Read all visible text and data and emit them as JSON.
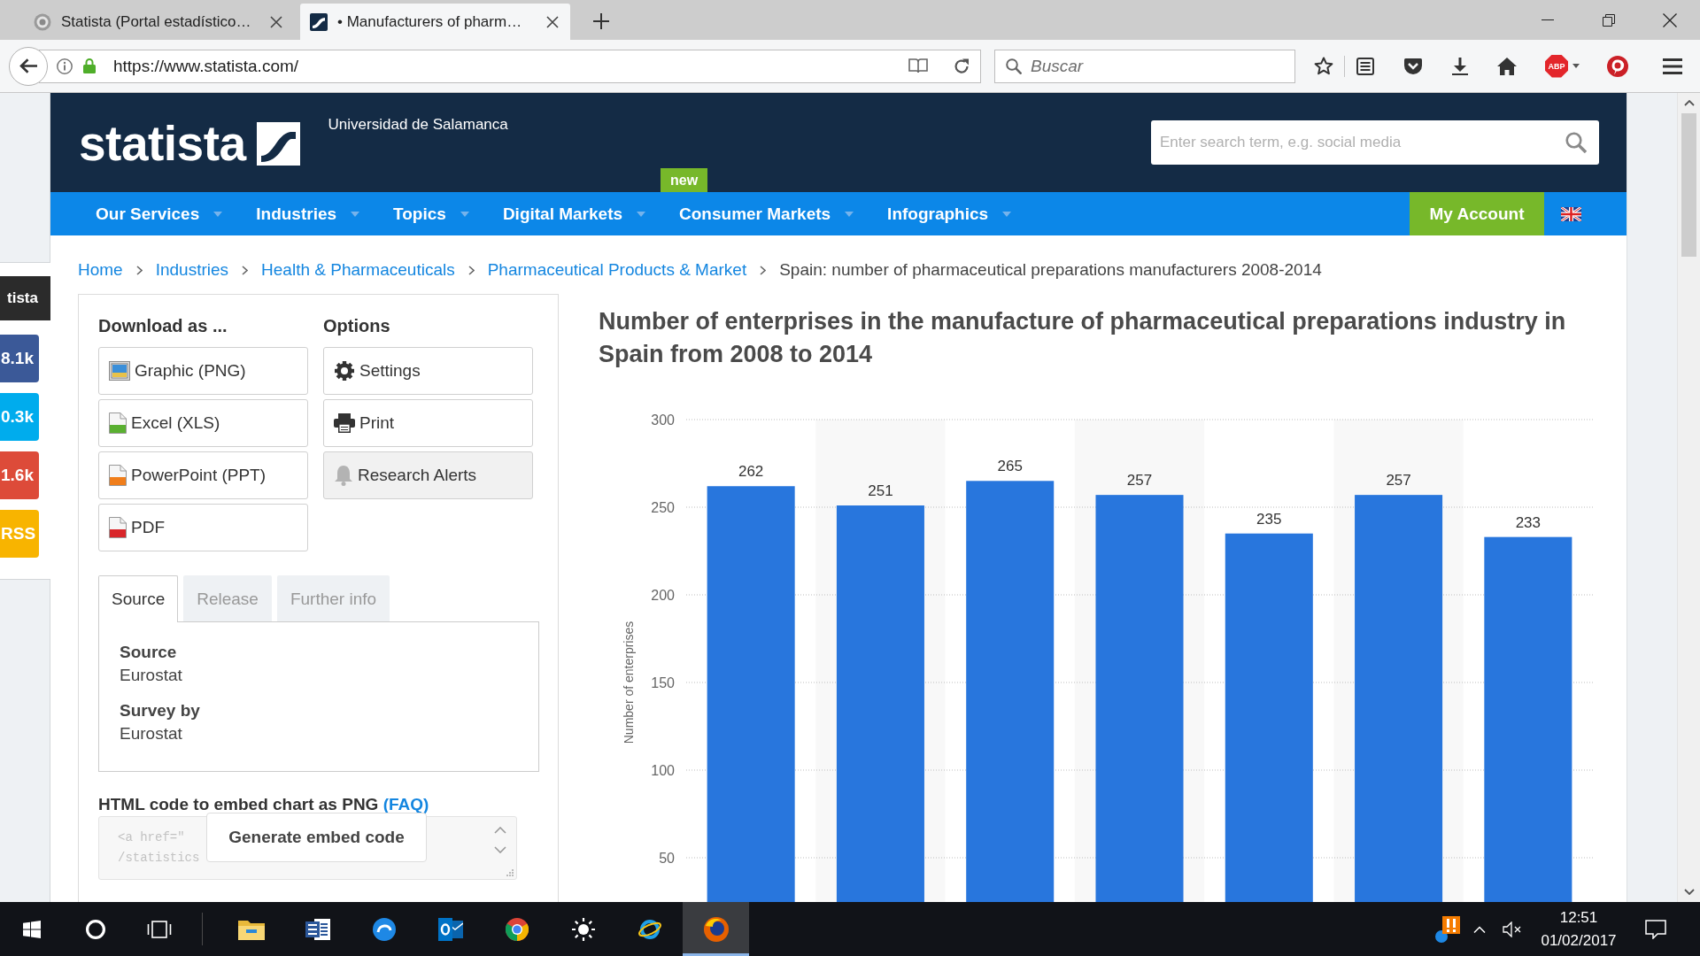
{
  "browser": {
    "tabs": [
      {
        "title": "Statista (Portal estadístico…",
        "kind": "seal",
        "selected": false
      },
      {
        "title": "• Manufacturers of pharm…",
        "kind": "logo",
        "selected": true
      }
    ],
    "url": "https://www.statista.com/",
    "search": {
      "placeholder": "Buscar"
    },
    "adblock_label": "ABP"
  },
  "site": {
    "logo": "statista",
    "institution": "Universidad de Salamanca",
    "search": {
      "placeholder": "Enter search term, e.g. social media"
    }
  },
  "nav": {
    "items": [
      {
        "label": "Our Services"
      },
      {
        "label": "Industries"
      },
      {
        "label": "Topics"
      },
      {
        "label": "Digital Markets"
      },
      {
        "label": "Consumer Markets",
        "badge": "new"
      },
      {
        "label": "Infographics"
      }
    ],
    "account": "My Account"
  },
  "social": [
    {
      "label": "tista",
      "kind": "brand",
      "color": "#2b2b2b"
    },
    {
      "label": "8.1k",
      "kind": "count",
      "color": "#3b5998"
    },
    {
      "label": "0.3k",
      "kind": "count",
      "color": "#00aced"
    },
    {
      "label": "1.6k",
      "kind": "count",
      "color": "#dd4b39"
    },
    {
      "label": "RSS",
      "kind": "count",
      "color": "#f8b400"
    }
  ],
  "breadcrumb": [
    {
      "label": "Home",
      "current": false
    },
    {
      "label": "Industries",
      "current": false
    },
    {
      "label": "Health & Pharmaceuticals",
      "current": false
    },
    {
      "label": "Pharmaceutical Products & Market",
      "current": false
    },
    {
      "label": "Spain: number of pharmaceutical preparations manufacturers 2008-2014",
      "current": true
    }
  ],
  "download": {
    "title": "Download as ...",
    "items": [
      {
        "label": "Graphic (PNG)",
        "kind": "png"
      },
      {
        "label": "Excel (XLS)",
        "kind": "xls"
      },
      {
        "label": "PowerPoint (PPT)",
        "kind": "ppt"
      },
      {
        "label": "PDF",
        "kind": "pdf"
      }
    ]
  },
  "options": {
    "title": "Options",
    "items": [
      {
        "label": "Settings",
        "kind": "settings",
        "disabled": false
      },
      {
        "label": "Print",
        "kind": "print",
        "disabled": false
      },
      {
        "label": "Research Alerts",
        "kind": "alerts",
        "disabled": true
      }
    ]
  },
  "info_tabs": [
    {
      "label": "Source",
      "selected": true
    },
    {
      "label": "Release",
      "selected": false
    },
    {
      "label": "Further info",
      "selected": false
    }
  ],
  "info": [
    {
      "heading": "Source",
      "value": "Eurostat"
    },
    {
      "heading": "Survey by",
      "value": "Eurostat"
    }
  ],
  "embed": {
    "label": "HTML code to embed chart as PNG",
    "link": "(FAQ)",
    "code": [
      "<a href=\"",
      "/statistics"
    ],
    "button": "Generate embed code"
  },
  "chart": {
    "chart_data": {
      "type": "bar",
      "title": "Number of enterprises in the manufacture of pharmaceutical preparations industry in Spain from 2008 to 2014",
      "ylabel": "Number of enterprises",
      "series": [
        {
          "color": "#2876dd",
          "values": [
            262,
            251,
            265,
            257,
            235,
            257,
            233
          ]
        }
      ],
      "ylim": [
        0,
        300
      ],
      "yticks": [
        50,
        100,
        150,
        200,
        250,
        300
      ],
      "grid": true,
      "data_labels": true
    }
  },
  "taskbar": {
    "apps": [
      {
        "kind": "explorer",
        "active": false
      },
      {
        "kind": "word",
        "active": false
      },
      {
        "kind": "edge",
        "active": false
      },
      {
        "kind": "outlook",
        "active": false
      },
      {
        "kind": "chrome",
        "active": false
      },
      {
        "kind": "brightness",
        "active": false
      },
      {
        "kind": "ie",
        "active": false
      },
      {
        "kind": "firefox",
        "active": true
      }
    ],
    "clock": {
      "time": "12:51",
      "date": "01/02/2017"
    }
  }
}
